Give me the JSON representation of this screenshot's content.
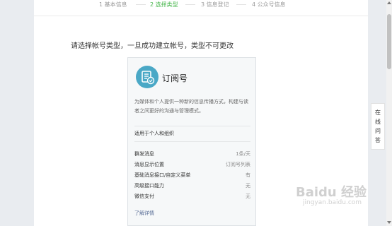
{
  "steps": [
    {
      "label": "1 基本信息",
      "active": false
    },
    {
      "label": "2 选择类型",
      "active": true
    },
    {
      "label": "3 信息登记",
      "active": false
    },
    {
      "label": "4 公众号信息",
      "active": false
    }
  ],
  "instruction": "请选择帐号类型，一旦成功建立帐号，类型不可更改",
  "card": {
    "title": "订阅号",
    "icon": "subscription-account-icon",
    "description": "为媒体和个人提供一种新的信息传播方式，构建与读者之间更好的沟通与管理模式。",
    "audience": "适用于个人和组织",
    "features": [
      {
        "name": "群发消息",
        "value": "1条/天"
      },
      {
        "name": "消息显示位置",
        "value": "订阅号列表"
      },
      {
        "name": "基础消息接口/自定义菜单",
        "value": "有"
      },
      {
        "name": "高级接口能力",
        "value": "无"
      },
      {
        "name": "微信支付",
        "value": "无"
      }
    ],
    "detail_link": "了解详情"
  },
  "qa_widget": [
    "在",
    "线",
    "问",
    "答"
  ],
  "watermark": {
    "text": "Baidu 经验",
    "url": "jingyan.baidu.com"
  },
  "colors": {
    "accent": "#44b549",
    "icon_bg": "#4aa8c6",
    "link": "#576b95"
  }
}
